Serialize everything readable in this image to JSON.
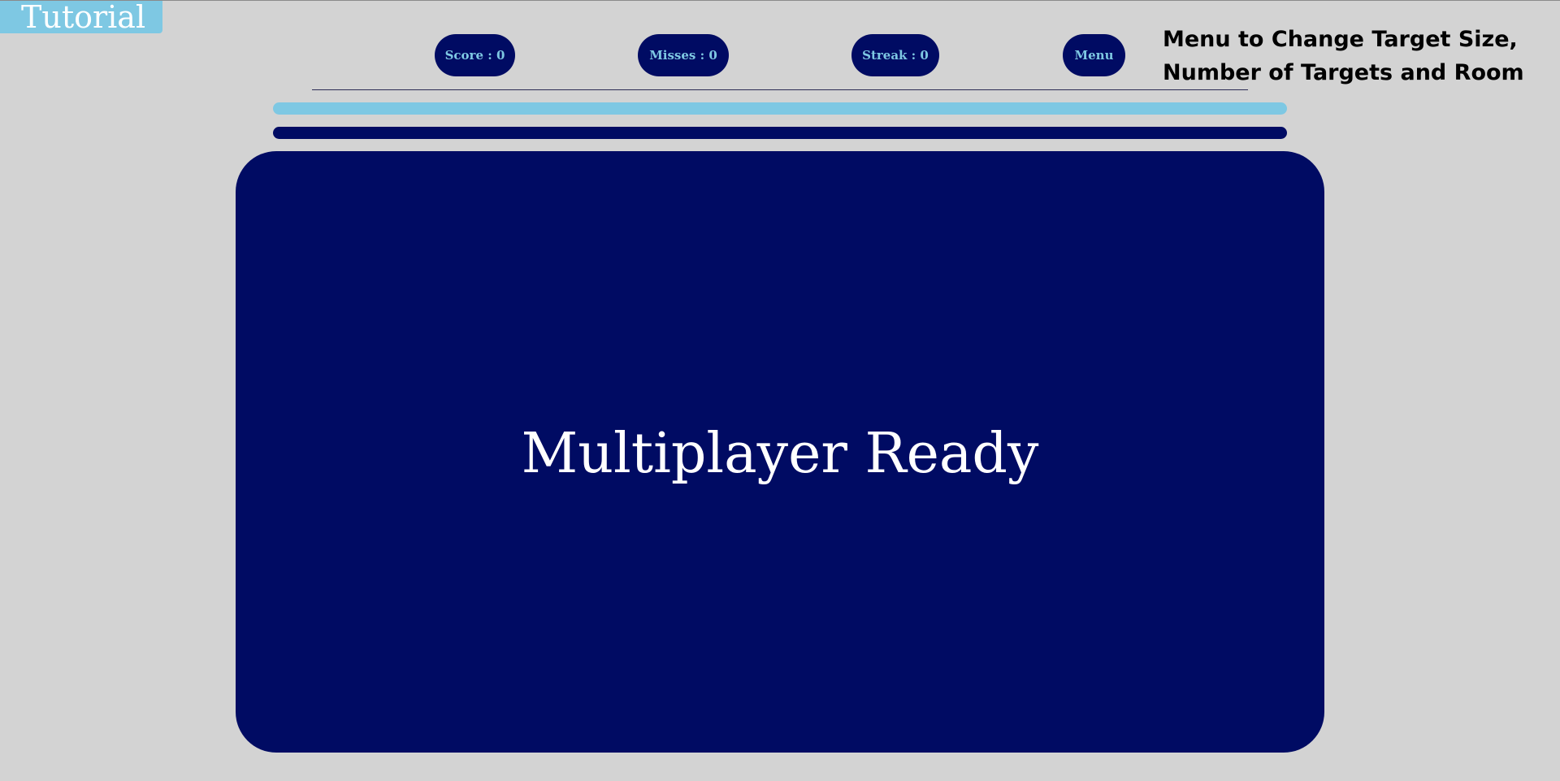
{
  "tutorial": {
    "label": "Tutorial"
  },
  "hud": {
    "score_label": "Score : 0",
    "misses_label": "Misses : 0",
    "streak_label": "Streak : 0",
    "menu_label": "Menu"
  },
  "annotation": {
    "line1": "Menu to Change Target Size,",
    "line2": "Number of Targets and Room"
  },
  "game": {
    "status": "Multiplayer Ready"
  },
  "colors": {
    "background": "#d3d3d3",
    "navy": "#000b63",
    "light_blue": "#7ec8e3",
    "white": "#ffffff"
  }
}
